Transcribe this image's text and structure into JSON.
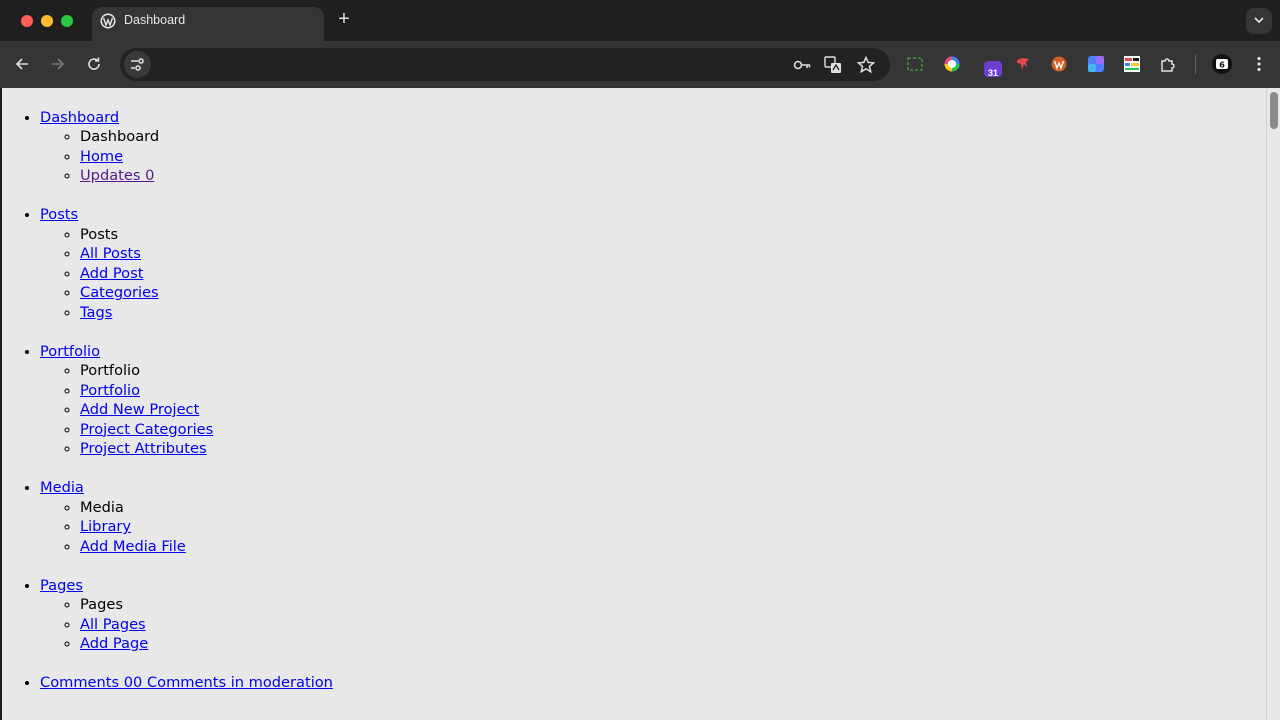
{
  "browser": {
    "tab_title": "Dashboard",
    "new_tab_glyph": "+",
    "favicon": "wordpress-icon",
    "toolbar_icons": [
      "back-icon",
      "forward-icon",
      "reload-icon",
      "site-settings-icon",
      "password-key-icon",
      "translate-icon",
      "bookmark-star-icon"
    ],
    "extension_icons": [
      "screen-capture-icon",
      "color-picker-icon",
      "calendar-31-icon",
      "bird-extension-icon",
      "wordpress-extension-icon",
      "grid-extension-icon",
      "notes-extension-icon",
      "puzzle-extensions-icon",
      "profile-icon",
      "more-menu-icon"
    ],
    "calendar_badge": "31"
  },
  "menu": [
    {
      "label": "Dashboard",
      "items": [
        {
          "label": "Dashboard",
          "link": false
        },
        {
          "label": "Home",
          "link": true
        },
        {
          "label": "Updates 0",
          "link": true,
          "visited": true
        }
      ]
    },
    {
      "label": "Posts",
      "items": [
        {
          "label": "Posts",
          "link": false
        },
        {
          "label": "All Posts",
          "link": true
        },
        {
          "label": "Add Post",
          "link": true
        },
        {
          "label": "Categories",
          "link": true
        },
        {
          "label": "Tags",
          "link": true
        }
      ]
    },
    {
      "label": "Portfolio",
      "items": [
        {
          "label": "Portfolio",
          "link": false
        },
        {
          "label": "Portfolio",
          "link": true
        },
        {
          "label": "Add New Project",
          "link": true
        },
        {
          "label": "Project Categories",
          "link": true
        },
        {
          "label": "Project Attributes",
          "link": true
        }
      ]
    },
    {
      "label": "Media",
      "items": [
        {
          "label": "Media",
          "link": false
        },
        {
          "label": "Library",
          "link": true
        },
        {
          "label": "Add Media File",
          "link": true
        }
      ]
    },
    {
      "label": "Pages",
      "items": [
        {
          "label": "Pages",
          "link": false
        },
        {
          "label": "All Pages",
          "link": true
        },
        {
          "label": "Add Page",
          "link": true
        }
      ]
    },
    {
      "label": "Comments 00 Comments in moderation",
      "items": []
    }
  ]
}
